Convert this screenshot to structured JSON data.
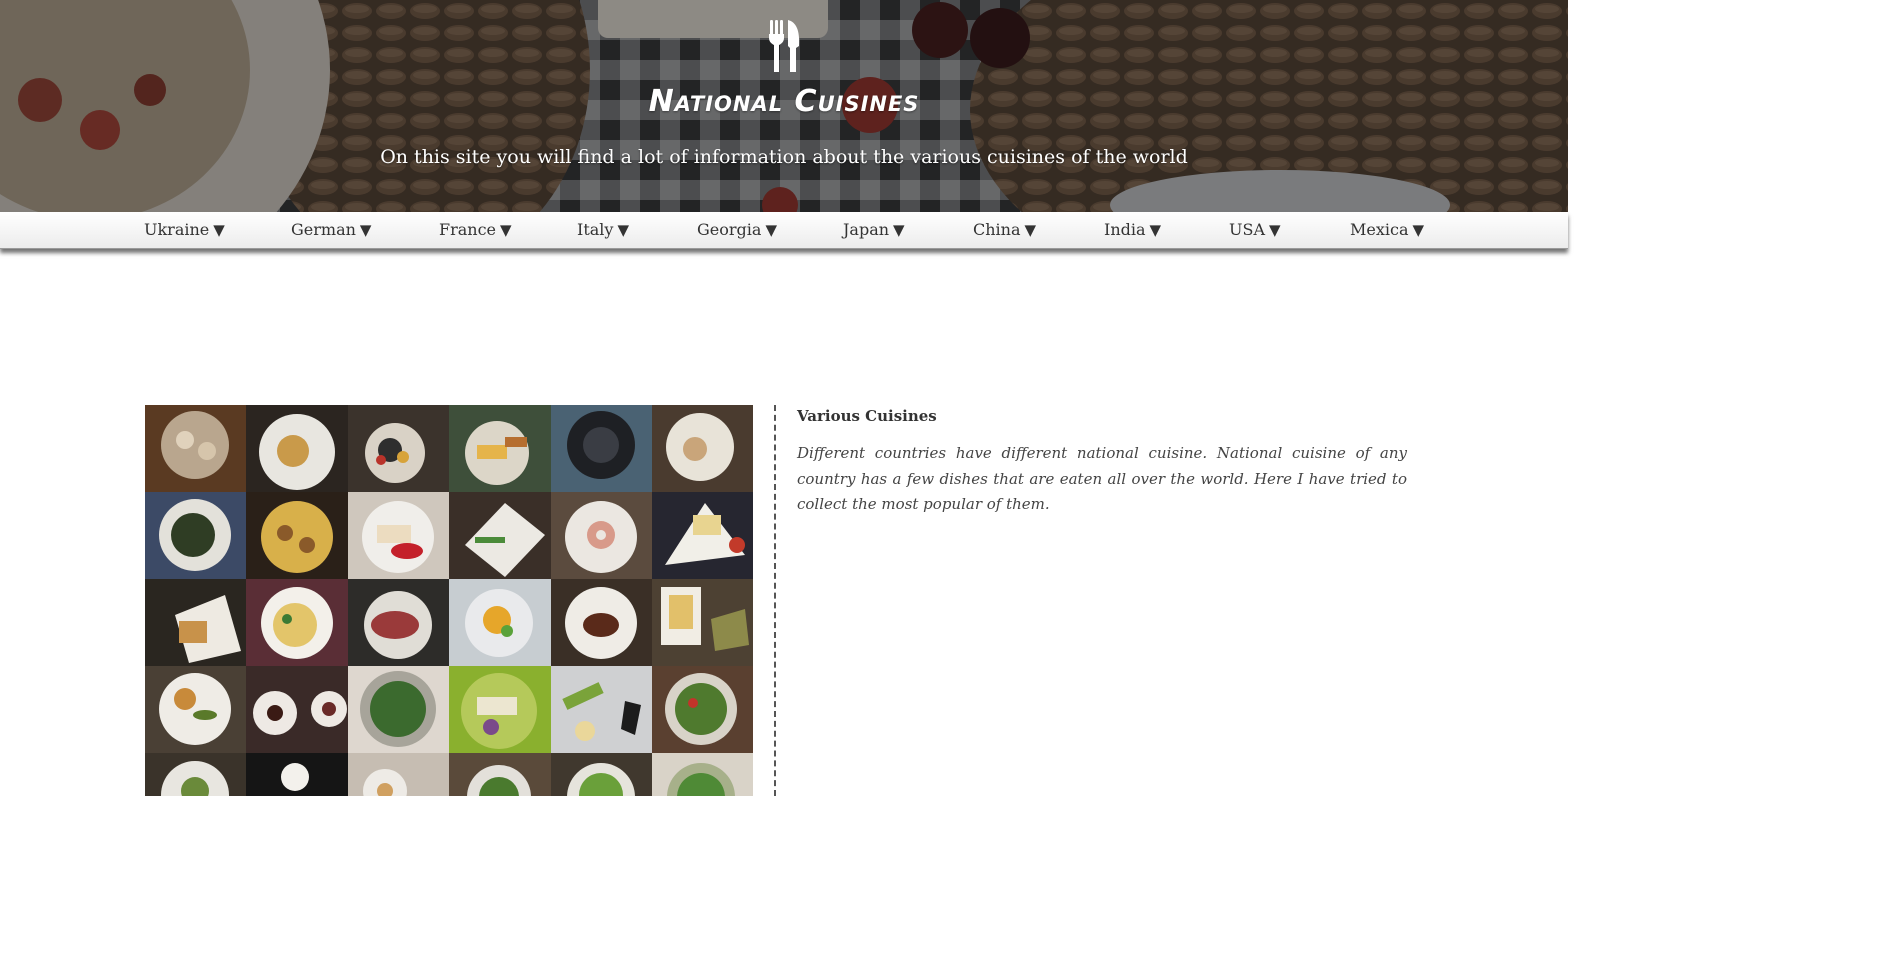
{
  "header": {
    "title": "National Cuisines",
    "subtitle": "On this site you will find a lot of information about the various cuisines of the world",
    "logo_icon": "fork-knife-icon"
  },
  "nav": {
    "items": [
      {
        "label": "Ukraine",
        "arrow": "▼"
      },
      {
        "label": "German",
        "arrow": "▼"
      },
      {
        "label": "France",
        "arrow": "▼"
      },
      {
        "label": "Italy",
        "arrow": "▼"
      },
      {
        "label": "Georgia",
        "arrow": "▼"
      },
      {
        "label": "Japan",
        "arrow": "▼"
      },
      {
        "label": "China",
        "arrow": "▼"
      },
      {
        "label": "India",
        "arrow": "▼"
      },
      {
        "label": "USA",
        "arrow": "▼"
      },
      {
        "label": "Mexica",
        "arrow": "▼"
      }
    ]
  },
  "content": {
    "section_title": "Various Cuisines",
    "section_text": "Different countries have different national cuisine. National cuisine of any country has a few dishes that are eaten all over the world. Here I have tried to collect the most popular of them.",
    "image_description_icon": "food-photo-mosaic"
  },
  "colors": {
    "nav_text": "#333333",
    "body_text": "#444444",
    "header_text": "#ffffff"
  }
}
